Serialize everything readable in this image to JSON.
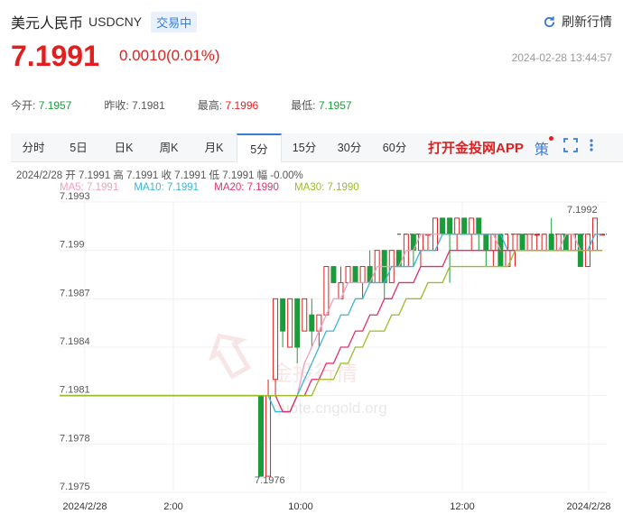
{
  "header": {
    "name": "美元人民币",
    "code": "USDCNY",
    "badge": "交易中",
    "refresh_label": "刷新行情",
    "price": "7.1991",
    "change": "0.0010(0.01%)",
    "timestamp": "2024-02-28 13:44:57"
  },
  "stats": [
    {
      "label": "今开:",
      "value": "7.1957",
      "color": "#1a9c3a"
    },
    {
      "label": "昨收:",
      "value": "7.1981",
      "color": "#555555"
    },
    {
      "label": "最高:",
      "value": "7.1996",
      "color": "#e02020"
    },
    {
      "label": "最低:",
      "value": "7.1957",
      "color": "#1a9c3a"
    }
  ],
  "tabs": [
    "分时",
    "5日",
    "日K",
    "周K",
    "月K",
    "5分",
    "15分",
    "30分",
    "60分"
  ],
  "active_tab": "5分",
  "promo": "打开金投网APP",
  "tool_label": "策",
  "info_line": "2024/2/28  开 7.1991  高 7.1991  收 7.1991  低 7.1991  幅 -0.00%",
  "ma_legend": [
    {
      "label": "MA5: 7.1991",
      "color": "#f29fc0"
    },
    {
      "label": "MA10: 7.1991",
      "color": "#3ab5d6"
    },
    {
      "label": "MA20: 7.1990",
      "color": "#e0306a"
    },
    {
      "label": "MA30: 7.1990",
      "color": "#9bbb2a"
    }
  ],
  "watermark": {
    "text": "金投行情",
    "url": "quote.cngold.org"
  },
  "colors": {
    "up": "#e02020",
    "down": "#1a9c3a",
    "accent": "#3a7bd5"
  },
  "chart_data": {
    "type": "candlestick",
    "y_ticks": [
      "7.1993",
      "7.199",
      "7.1987",
      "7.1984",
      "7.1981",
      "7.1978",
      "7.1975"
    ],
    "x_ticks": [
      "2024/2/28",
      "2:00",
      "10:00",
      "12:00",
      "2024/2/28"
    ],
    "ylim": [
      7.1975,
      7.1993
    ],
    "prev_close": 7.1981,
    "annotations": [
      {
        "text": "7.1992",
        "value": 7.1992
      },
      {
        "text": "7.1976",
        "value": 7.1976
      }
    ],
    "candles": [
      {
        "o": 7.1981,
        "c": 7.1976,
        "h": 7.1981,
        "l": 7.1976
      },
      {
        "o": 7.1976,
        "c": 7.1981,
        "h": 7.1982,
        "l": 7.1976
      },
      {
        "o": 7.1982,
        "c": 7.1987,
        "h": 7.1987,
        "l": 7.1981
      },
      {
        "o": 7.1987,
        "c": 7.1985,
        "h": 7.1987,
        "l": 7.1984
      },
      {
        "o": 7.1984,
        "c": 7.1987,
        "h": 7.1987,
        "l": 7.1984
      },
      {
        "o": 7.1987,
        "c": 7.1984,
        "h": 7.1987,
        "l": 7.1983
      },
      {
        "o": 7.1985,
        "c": 7.1987,
        "h": 7.1987,
        "l": 7.1985
      },
      {
        "o": 7.1986,
        "c": 7.1985,
        "h": 7.1987,
        "l": 7.1984
      },
      {
        "o": 7.1985,
        "c": 7.1986,
        "h": 7.1986,
        "l": 7.1984
      },
      {
        "o": 7.1986,
        "c": 7.1989,
        "h": 7.1989,
        "l": 7.1986
      },
      {
        "o": 7.1989,
        "c": 7.1988,
        "h": 7.1989,
        "l": 7.1988
      },
      {
        "o": 7.1987,
        "c": 7.1988,
        "h": 7.1989,
        "l": 7.1987
      },
      {
        "o": 7.1988,
        "c": 7.1989,
        "h": 7.1989,
        "l": 7.1988
      },
      {
        "o": 7.1989,
        "c": 7.1988,
        "h": 7.1989,
        "l": 7.1988
      },
      {
        "o": 7.1988,
        "c": 7.1989,
        "h": 7.1989,
        "l": 7.1987
      },
      {
        "o": 7.1989,
        "c": 7.1988,
        "h": 7.199,
        "l": 7.1988
      },
      {
        "o": 7.1988,
        "c": 7.199,
        "h": 7.199,
        "l": 7.1988
      },
      {
        "o": 7.199,
        "c": 7.1988,
        "h": 7.199,
        "l": 7.1987
      },
      {
        "o": 7.1988,
        "c": 7.199,
        "h": 7.199,
        "l": 7.1988
      },
      {
        "o": 7.199,
        "c": 7.1989,
        "h": 7.199,
        "l": 7.1989
      },
      {
        "o": 7.1989,
        "c": 7.1991,
        "h": 7.1991,
        "l": 7.1989
      },
      {
        "o": 7.1991,
        "c": 7.199,
        "h": 7.1991,
        "l": 7.1989
      },
      {
        "o": 7.199,
        "c": 7.1991,
        "h": 7.1991,
        "l": 7.1989
      },
      {
        "o": 7.1991,
        "c": 7.1991,
        "h": 7.1991,
        "l": 7.199
      },
      {
        "o": 7.199,
        "c": 7.1992,
        "h": 7.1992,
        "l": 7.199
      },
      {
        "o": 7.1992,
        "c": 7.1991,
        "h": 7.1992,
        "l": 7.1991
      },
      {
        "o": 7.1992,
        "c": 7.1991,
        "h": 7.1992,
        "l": 7.1988
      },
      {
        "o": 7.1991,
        "c": 7.1992,
        "h": 7.1992,
        "l": 7.199
      },
      {
        "o": 7.1992,
        "c": 7.1991,
        "h": 7.1992,
        "l": 7.1991
      },
      {
        "o": 7.1991,
        "c": 7.1992,
        "h": 7.1992,
        "l": 7.199
      },
      {
        "o": 7.1992,
        "c": 7.1991,
        "h": 7.1992,
        "l": 7.199
      },
      {
        "o": 7.1991,
        "c": 7.199,
        "h": 7.1991,
        "l": 7.1989
      },
      {
        "o": 7.199,
        "c": 7.1991,
        "h": 7.1991,
        "l": 7.1989
      },
      {
        "o": 7.1991,
        "c": 7.1989,
        "h": 7.1991,
        "l": 7.1989
      },
      {
        "o": 7.1989,
        "c": 7.199,
        "h": 7.1991,
        "l": 7.1989
      },
      {
        "o": 7.199,
        "c": 7.1991,
        "h": 7.1991,
        "l": 7.1989
      },
      {
        "o": 7.1991,
        "c": 7.199,
        "h": 7.1991,
        "l": 7.199
      },
      {
        "o": 7.199,
        "c": 7.1991,
        "h": 7.1991,
        "l": 7.199
      },
      {
        "o": 7.1991,
        "c": 7.1991,
        "h": 7.1991,
        "l": 7.199
      },
      {
        "o": 7.199,
        "c": 7.1991,
        "h": 7.1991,
        "l": 7.199
      },
      {
        "o": 7.1991,
        "c": 7.199,
        "h": 7.1992,
        "l": 7.199
      },
      {
        "o": 7.199,
        "c": 7.1991,
        "h": 7.1991,
        "l": 7.199
      },
      {
        "o": 7.1991,
        "c": 7.199,
        "h": 7.1991,
        "l": 7.199
      },
      {
        "o": 7.199,
        "c": 7.1991,
        "h": 7.1991,
        "l": 7.199
      },
      {
        "o": 7.1991,
        "c": 7.1989,
        "h": 7.1991,
        "l": 7.1989
      },
      {
        "o": 7.1989,
        "c": 7.1991,
        "h": 7.1991,
        "l": 7.1989
      },
      {
        "o": 7.199,
        "c": 7.1992,
        "h": 7.1992,
        "l": 7.199
      },
      {
        "o": 7.1991,
        "c": 7.1991,
        "h": 7.1991,
        "l": 7.1991
      }
    ],
    "series": [
      {
        "name": "MA5",
        "color": "#f29fc0",
        "values": [
          7.1981,
          7.1981,
          7.1981,
          7.198,
          7.198,
          7.1981,
          7.1983,
          7.1984,
          7.1985,
          7.1986,
          7.1987,
          7.1987,
          7.1988,
          7.1988,
          7.1988,
          7.1988,
          7.1989,
          7.1989,
          7.1989,
          7.1989,
          7.199,
          7.199,
          7.1991,
          7.1991,
          7.1991,
          7.1991,
          7.1991,
          7.1991,
          7.1991,
          7.1991,
          7.1991,
          7.1991,
          7.1991,
          7.199,
          7.199,
          7.199,
          7.199,
          7.199,
          7.199,
          7.199,
          7.199,
          7.199,
          7.1991,
          7.1991,
          7.199,
          7.199,
          7.1991,
          7.1991
        ]
      },
      {
        "name": "MA10",
        "color": "#3ab5d6",
        "values": [
          7.1981,
          7.1981,
          7.198,
          7.198,
          7.198,
          7.1981,
          7.1982,
          7.1983,
          7.1984,
          7.1985,
          7.1985,
          7.1986,
          7.1986,
          7.1987,
          7.1987,
          7.1988,
          7.1988,
          7.1988,
          7.1989,
          7.1989,
          7.1989,
          7.1989,
          7.199,
          7.199,
          7.199,
          7.1991,
          7.1991,
          7.1991,
          7.1991,
          7.1991,
          7.1991,
          7.1991,
          7.1991,
          7.1991,
          7.199,
          7.199,
          7.199,
          7.199,
          7.199,
          7.199,
          7.199,
          7.199,
          7.199,
          7.199,
          7.199,
          7.199,
          7.1991,
          7.1991
        ]
      },
      {
        "name": "MA20",
        "color": "#e0306a",
        "values": [
          7.1981,
          7.1981,
          7.1981,
          7.198,
          7.198,
          7.1981,
          7.1981,
          7.1982,
          7.1982,
          7.1983,
          7.1983,
          7.1984,
          7.1984,
          7.1985,
          7.1985,
          7.1986,
          7.1986,
          7.1987,
          7.1987,
          7.1988,
          7.1988,
          7.1988,
          7.1989,
          7.1989,
          7.1989,
          7.1989,
          7.199,
          7.199,
          7.199,
          7.199,
          7.199,
          7.199,
          7.199,
          7.199,
          7.199,
          7.199,
          7.199,
          7.199,
          7.199,
          7.199,
          7.199,
          7.199,
          7.199,
          7.199,
          7.199,
          7.199,
          7.199,
          7.199
        ]
      },
      {
        "name": "MA30",
        "color": "#9bbb2a",
        "values": [
          7.1981,
          7.1981,
          7.1981,
          7.1981,
          7.1981,
          7.1981,
          7.1981,
          7.1981,
          7.1982,
          7.1982,
          7.1982,
          7.1983,
          7.1983,
          7.1984,
          7.1984,
          7.1985,
          7.1985,
          7.1985,
          7.1986,
          7.1986,
          7.1987,
          7.1987,
          7.1987,
          7.1988,
          7.1988,
          7.1988,
          7.1989,
          7.1989,
          7.1989,
          7.1989,
          7.1989,
          7.1989,
          7.1989,
          7.1989,
          7.1989,
          7.199,
          7.199,
          7.199,
          7.199,
          7.199,
          7.199,
          7.199,
          7.199,
          7.199,
          7.199,
          7.199,
          7.199,
          7.199
        ]
      }
    ]
  }
}
